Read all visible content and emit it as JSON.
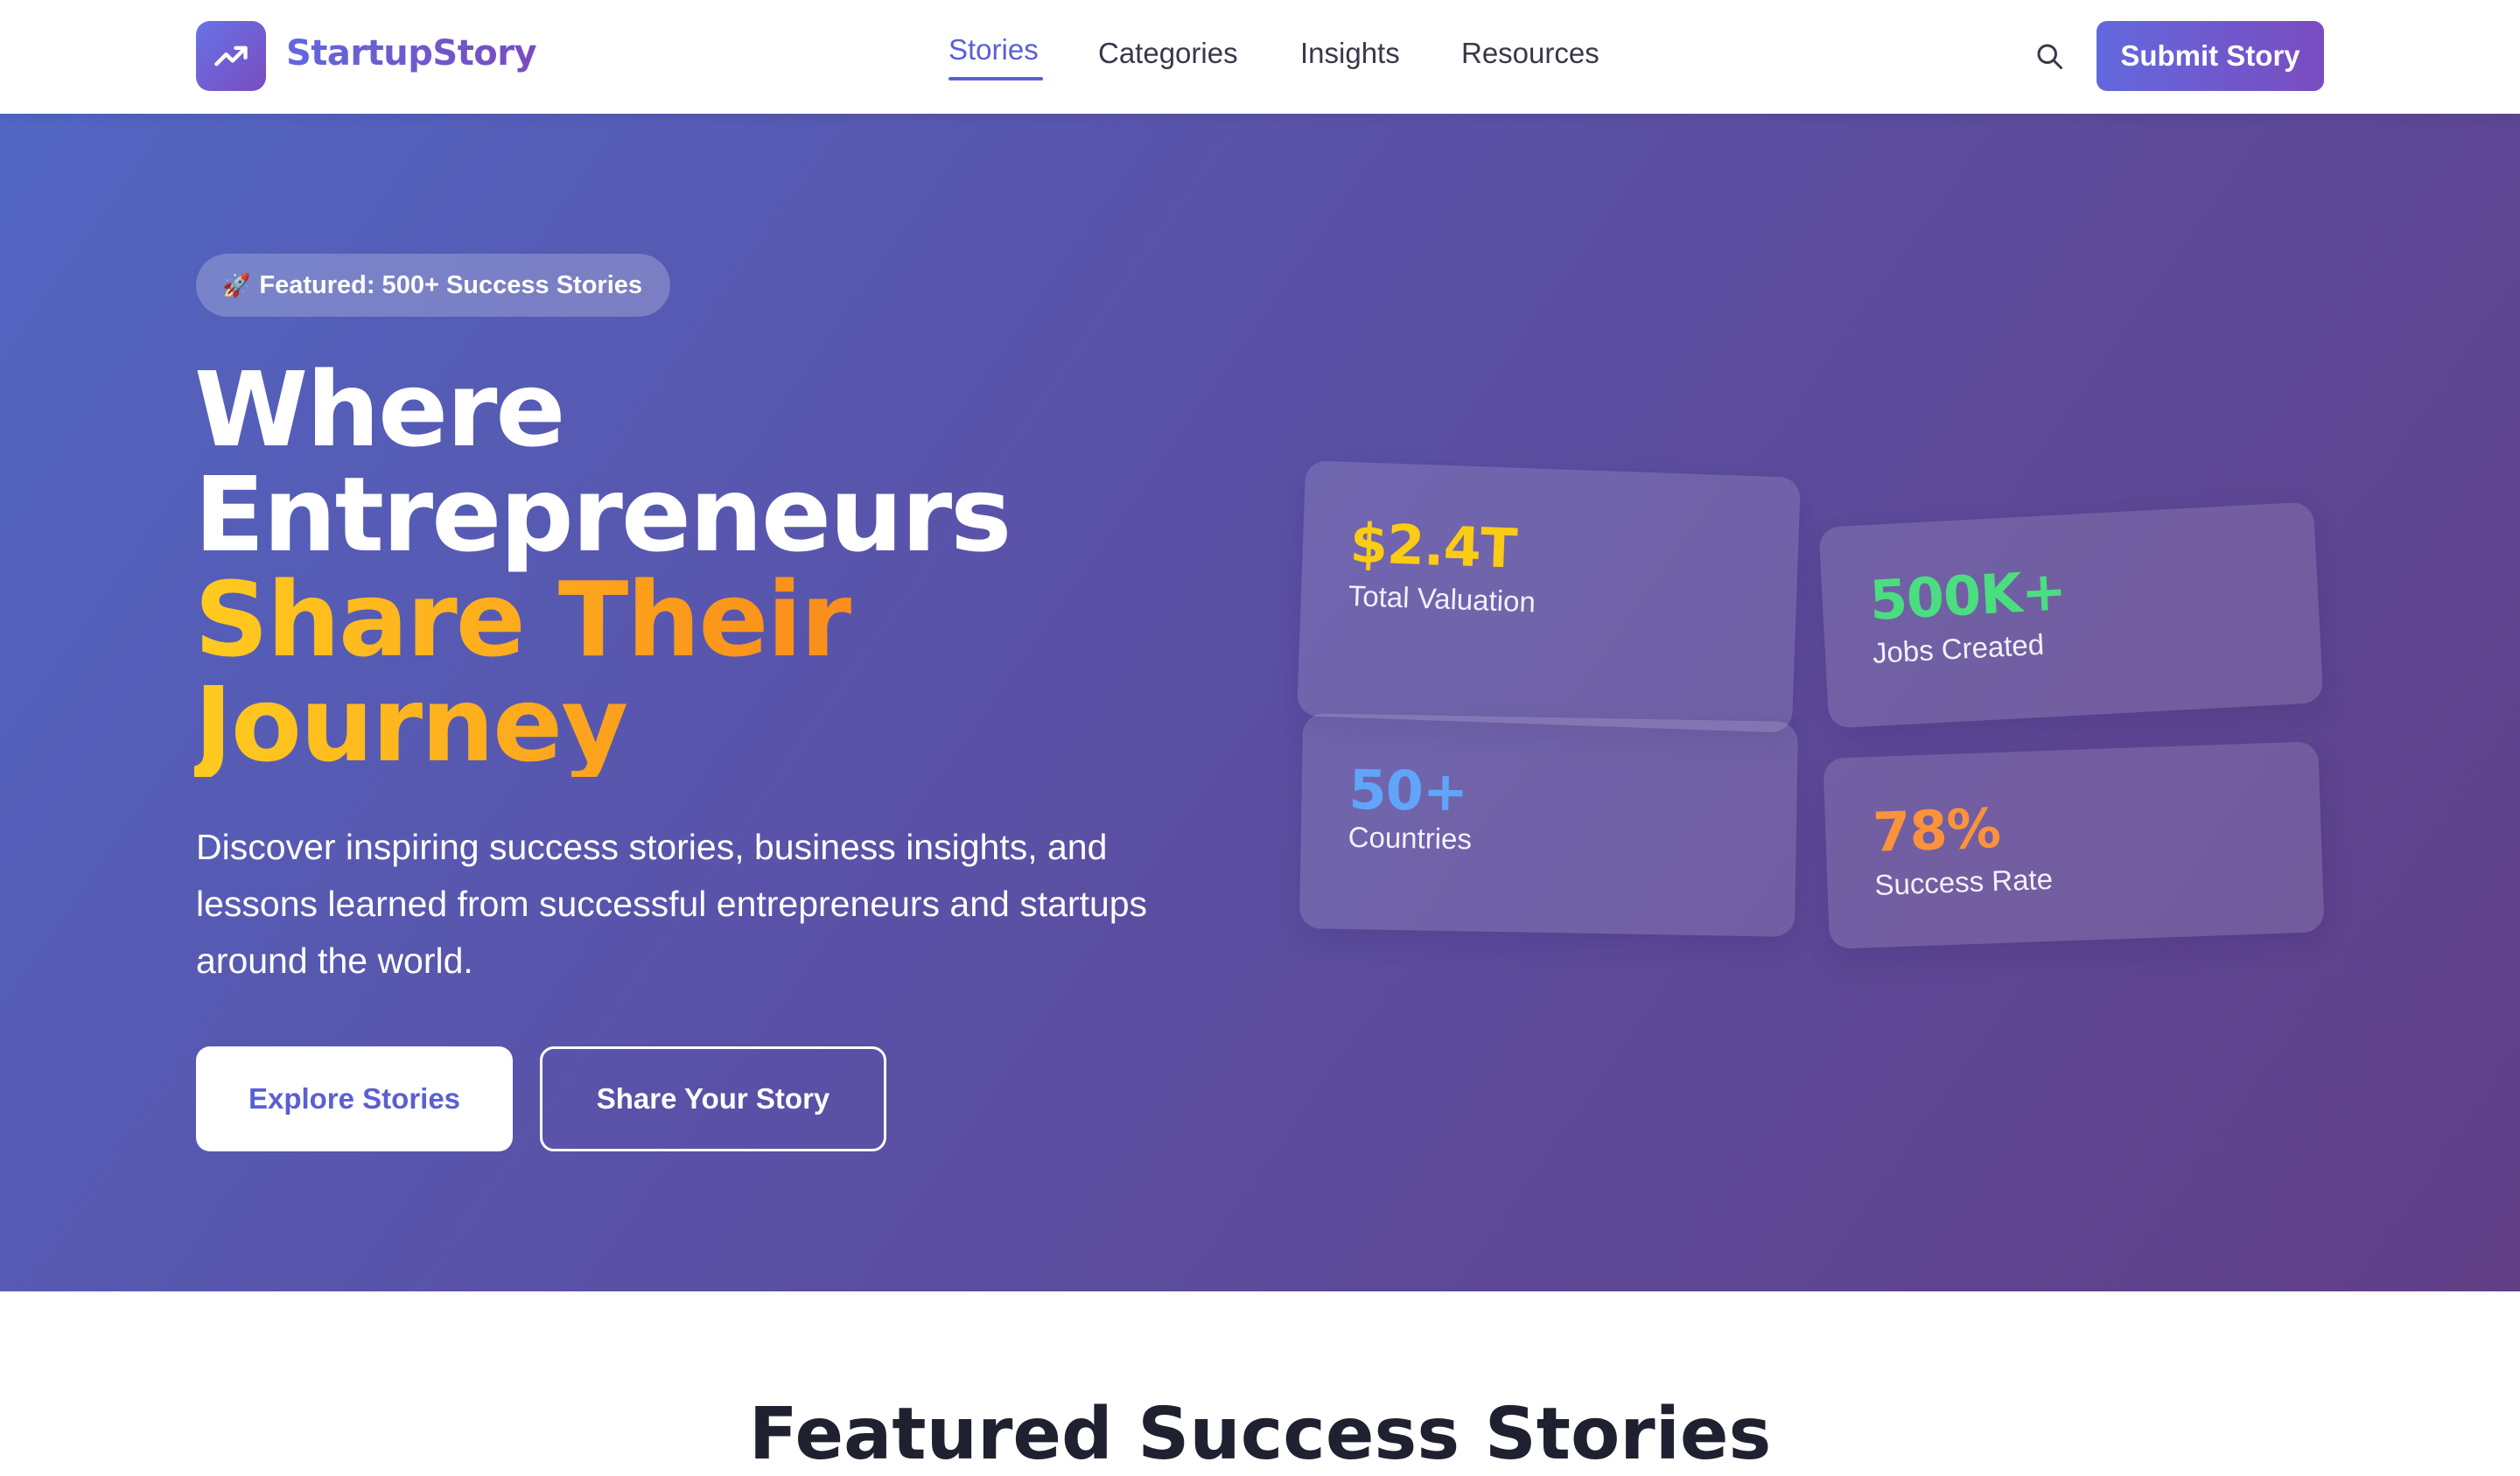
{
  "brand": {
    "name": "StartupStory",
    "logo_icon": "trending-up-icon",
    "gradient": [
      "#6673e6",
      "#7a4cc0"
    ]
  },
  "nav": {
    "links": [
      {
        "label": "Stories",
        "active": true
      },
      {
        "label": "Categories",
        "active": false
      },
      {
        "label": "Insights",
        "active": false
      },
      {
        "label": "Resources",
        "active": false
      }
    ],
    "search_icon": "search-icon",
    "submit_label": "Submit Story",
    "active_color": "#5b5fd6"
  },
  "hero": {
    "badge": {
      "emoji": "🚀",
      "text": "Featured: 500+ Success Stories"
    },
    "headline": {
      "line1": "Where",
      "line2": "Entrepreneurs",
      "accent_line1": "Share Their",
      "accent_line2": "Journey"
    },
    "description": "Discover inspiring success stories, business insights, and lessons learned from successful entrepreneurs and startups around the world.",
    "primary_cta": "Explore Stories",
    "secondary_cta": "Share Your Story",
    "accent_gradient": [
      "#ffcb1f",
      "#f7821c"
    ]
  },
  "stats": [
    {
      "value": "$2.4T",
      "label": "Total Valuation",
      "color": "#facc15"
    },
    {
      "value": "500K+",
      "label": "Jobs Created",
      "color": "#4ade80"
    },
    {
      "value": "50+",
      "label": "Countries",
      "color": "#60a5fa"
    },
    {
      "value": "78%",
      "label": "Success Rate",
      "color": "#fb923c"
    }
  ],
  "featured": {
    "title": "Featured Success Stories"
  }
}
